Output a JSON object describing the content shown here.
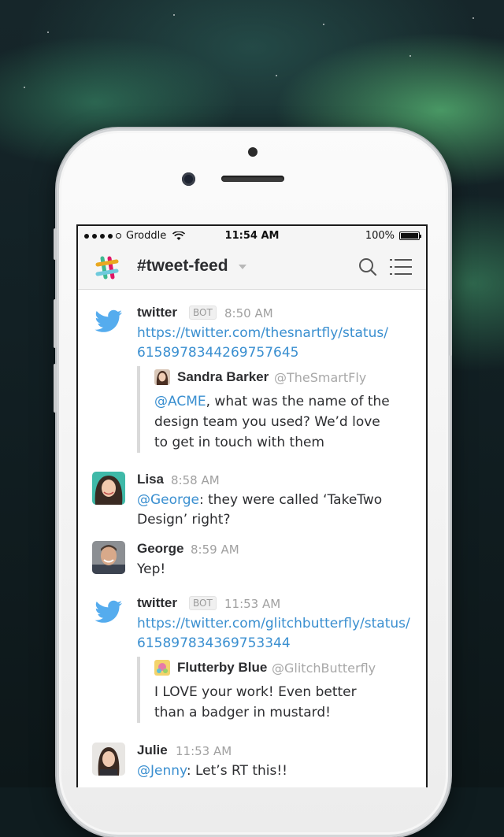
{
  "status_bar": {
    "carrier": "Groddle",
    "time": "11:54 AM",
    "battery": "100%"
  },
  "header": {
    "channel": "#tweet-feed"
  },
  "messages": [
    {
      "author": "twitter",
      "badge": "BOT",
      "time": "8:50 AM",
      "link_line1": "https://twitter.com/thesnartfly/status/",
      "link_line2": "615897834426975764​5",
      "quote": {
        "name": "Sandra Barker",
        "handle": "@TheSmartFly",
        "mention": "@ACME",
        "text_rest": ", what was the name of the design team you used? We’d love to get in touch with them"
      }
    },
    {
      "author": "Lisa",
      "time": "8:58 AM",
      "mention": "@George",
      "text_rest": ": they were called ‘TakeTwo Design’ right?"
    },
    {
      "author": "George",
      "time": "8:59 AM",
      "text": "Yep!"
    },
    {
      "author": "twitter",
      "badge": "BOT",
      "time": "11:53 AM",
      "link_line1": "https://twitter.com/glitchbutterfly/status/",
      "link_line2": "615897834369753344",
      "quote": {
        "name": "Flutterby Blue",
        "handle": "@GlitchButterfly",
        "text": "I LOVE your work! Even better than a badger in mustard!"
      }
    },
    {
      "author": "Julie",
      "time": "11:53 AM",
      "mention": "@Jenny",
      "text_rest": ": Let’s RT this!!"
    }
  ],
  "colors": {
    "link": "#3a8fd0",
    "twitter_blue": "#55acee",
    "name_text": "#2c2d30",
    "timestamp": "#a0a0a0"
  }
}
